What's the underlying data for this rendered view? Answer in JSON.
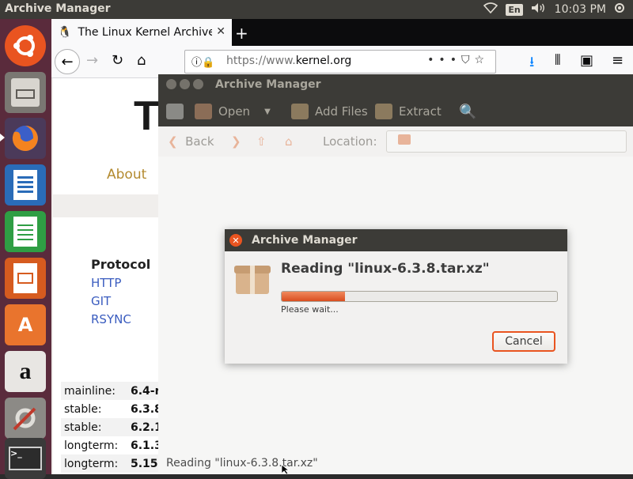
{
  "top_panel": {
    "app_title": "Archive Manager",
    "lang": "En",
    "time": "10:03 PM"
  },
  "launcher": {
    "items": [
      {
        "name": "ubuntu-dash",
        "icon": "ubuntu-logo-icon"
      },
      {
        "name": "files",
        "icon": "file-cabinet-icon"
      },
      {
        "name": "firefox",
        "icon": "firefox-icon"
      },
      {
        "name": "writer",
        "icon": "libreoffice-writer-icon"
      },
      {
        "name": "calc",
        "icon": "libreoffice-calc-icon"
      },
      {
        "name": "impress",
        "icon": "libreoffice-impress-icon"
      },
      {
        "name": "software",
        "icon": "software-center-icon"
      },
      {
        "name": "amazon",
        "icon": "amazon-icon"
      },
      {
        "name": "system-settings",
        "icon": "settings-tools-icon"
      },
      {
        "name": "terminal",
        "icon": "terminal-icon"
      }
    ]
  },
  "browser": {
    "tab_title": "The Linux Kernel Archive",
    "url_prefix": "https://www.",
    "url_domain": "kernel.org",
    "page": {
      "hero_text": "Th",
      "about_label": "About",
      "protocol_title": "Protocol",
      "protocols": [
        "HTTP",
        "GIT",
        "RSYNC"
      ],
      "releases": [
        {
          "kind": "mainline:",
          "version": "6.4-r"
        },
        {
          "kind": "stable:",
          "version": "6.3.8"
        },
        {
          "kind": "stable:",
          "version": "6.2.1"
        },
        {
          "kind": "longterm:",
          "version": "6.1.3"
        },
        {
          "kind": "longterm:",
          "version": "5.15"
        }
      ]
    }
  },
  "archive_manager": {
    "window_title": "Archive Manager",
    "toolbar": {
      "open": "Open",
      "add_files": "Add Files",
      "extract": "Extract"
    },
    "locbar": {
      "back": "Back",
      "location_label": "Location:"
    },
    "status_text": "Reading \"linux-6.3.8.tar.xz\""
  },
  "dialog": {
    "title": "Archive Manager",
    "heading": "Reading \"linux-6.3.8.tar.xz\"",
    "subtext": "Please wait...",
    "progress_percent": 23,
    "cancel_label": "Cancel"
  },
  "colors": {
    "accent_orange": "#e95420",
    "panel_dark": "#3c3b37",
    "launcher_bg": "#5a2b3c"
  }
}
